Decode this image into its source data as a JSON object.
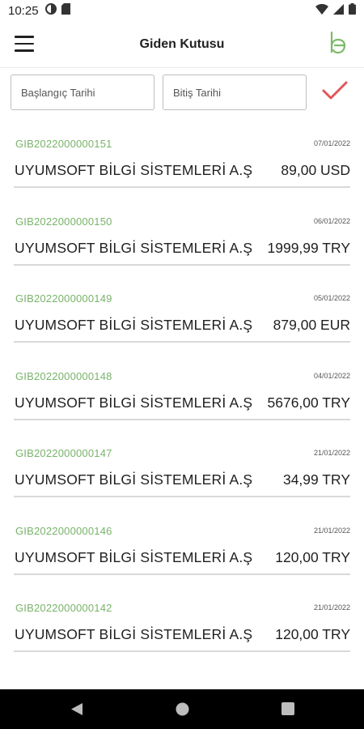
{
  "status_bar": {
    "time": "10:25"
  },
  "app_bar": {
    "title": "Giden Kutusu",
    "brand_color": "#7cba68"
  },
  "filters": {
    "start_placeholder": "Başlangıç Tarihi",
    "end_placeholder": "Bitiş Tarihi",
    "accent_color": "#e98583"
  },
  "invoices": [
    {
      "id": "GIB2022000000151",
      "date": "07/01/2022",
      "company": "UYUMSOFT BİLGİ SİSTEMLERİ A.Ş",
      "amount": "89,00 USD"
    },
    {
      "id": "GIB2022000000150",
      "date": "06/01/2022",
      "company": "UYUMSOFT BİLGİ SİSTEMLERİ A.Ş",
      "amount": "1999,99 TRY"
    },
    {
      "id": "GIB2022000000149",
      "date": "05/01/2022",
      "company": "UYUMSOFT BİLGİ SİSTEMLERİ A.Ş",
      "amount": "879,00 EUR"
    },
    {
      "id": "GIB2022000000148",
      "date": "04/01/2022",
      "company": "UYUMSOFT BİLGİ SİSTEMLERİ A.Ş",
      "amount": "5676,00 TRY"
    },
    {
      "id": "GIB2022000000147",
      "date": "21/01/2022",
      "company": "UYUMSOFT BİLGİ SİSTEMLERİ A.Ş",
      "amount": "34,99 TRY"
    },
    {
      "id": "GIB2022000000146",
      "date": "21/01/2022",
      "company": "UYUMSOFT BİLGİ SİSTEMLERİ A.Ş",
      "amount": "120,00 TRY"
    },
    {
      "id": "GIB2022000000142",
      "date": "21/01/2022",
      "company": "UYUMSOFT BİLGİ SİSTEMLERİ A.Ş",
      "amount": "120,00 TRY"
    }
  ],
  "icons": {
    "menu": "hamburger-menu-icon",
    "logo": "brand-logo-icon",
    "calendar": "calendar-icon",
    "confirm": "checkmark-icon",
    "back": "back-triangle-icon",
    "home": "home-circle-icon",
    "recents": "recents-square-icon"
  }
}
